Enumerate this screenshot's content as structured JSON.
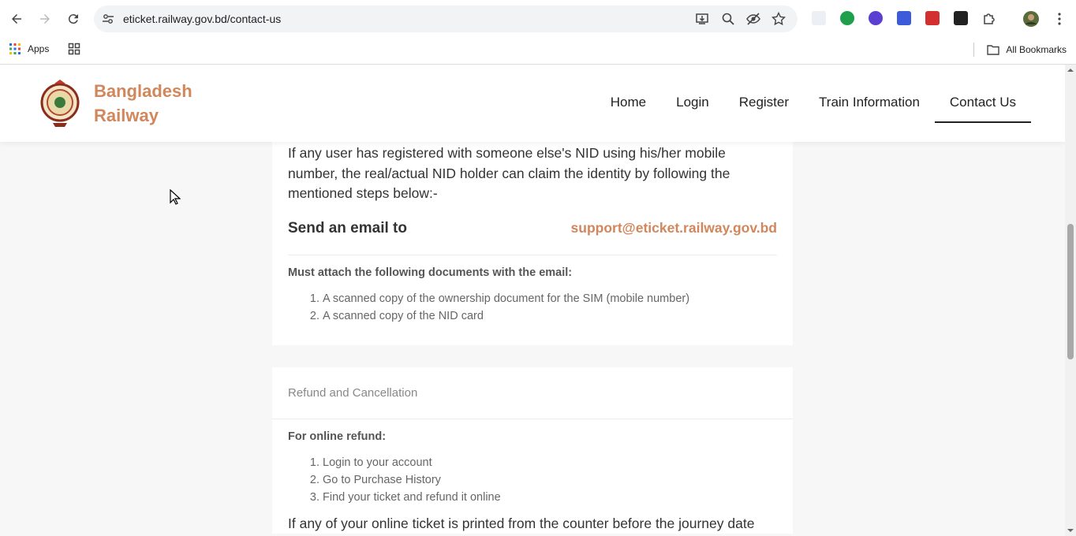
{
  "browser": {
    "url": "eticket.railway.gov.bd/contact-us",
    "bookmarks": {
      "apps_label": "Apps",
      "all_bookmarks_label": "All Bookmarks"
    }
  },
  "site": {
    "brand_line1": "Bangladesh",
    "brand_line2": "Railway",
    "nav": {
      "home": "Home",
      "login": "Login",
      "register": "Register",
      "train_info": "Train Information",
      "contact": "Contact Us"
    }
  },
  "nid_claim": {
    "intro": "If any user has registered with someone else's NID using his/her mobile number, the real/actual NID holder can claim the identity by following the mentioned steps below:-",
    "email_title": "Send an email to",
    "email": "support@eticket.railway.gov.bd",
    "docs_title": "Must attach the following documents with the email:",
    "docs": [
      "A scanned copy of the ownership document for the SIM (mobile number)",
      "A scanned copy of the NID card"
    ]
  },
  "refund": {
    "heading": "Refund and Cancellation",
    "online_title": "For online refund:",
    "steps": [
      "Login to your account",
      "Go to Purchase History",
      "Find your ticket and refund it online"
    ],
    "more": "If any of your online ticket is printed from the counter before the journey date"
  },
  "colors": {
    "accent": "#d1875b"
  }
}
